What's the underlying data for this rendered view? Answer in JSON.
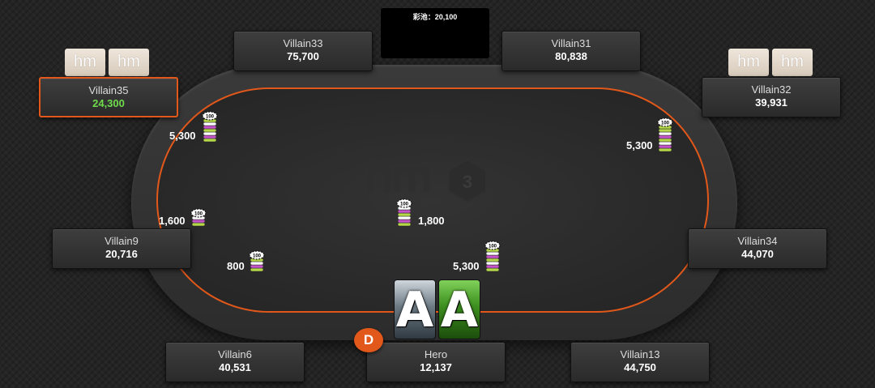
{
  "pot": {
    "label": "彩池：20,100"
  },
  "seats": {
    "villain33": {
      "name": "Villain33",
      "stack": "75,700"
    },
    "villain31": {
      "name": "Villain31",
      "stack": "80,838"
    },
    "villain35": {
      "name": "Villain35",
      "stack": "24,300"
    },
    "villain32": {
      "name": "Villain32",
      "stack": "39,931"
    },
    "villain9": {
      "name": "Villain9",
      "stack": "20,716"
    },
    "villain34": {
      "name": "Villain34",
      "stack": "44,070"
    },
    "villain6": {
      "name": "Villain6",
      "stack": "40,531"
    },
    "hero": {
      "name": "Hero",
      "stack": "12,137"
    },
    "villain13": {
      "name": "Villain13",
      "stack": "44,750"
    }
  },
  "hud_badges": {
    "label": "hm"
  },
  "bets": {
    "villain35": "5,300",
    "villain32": "5,300",
    "villain9": "1,600",
    "center": "1,800",
    "villain6": "800",
    "hero": "5,300"
  },
  "hero_cards": [
    "A",
    "A"
  ],
  "dealer_button": "D",
  "chip_face": "100",
  "colors": {
    "accent": "#e2581a",
    "active_stack": "#6fdc4c"
  }
}
